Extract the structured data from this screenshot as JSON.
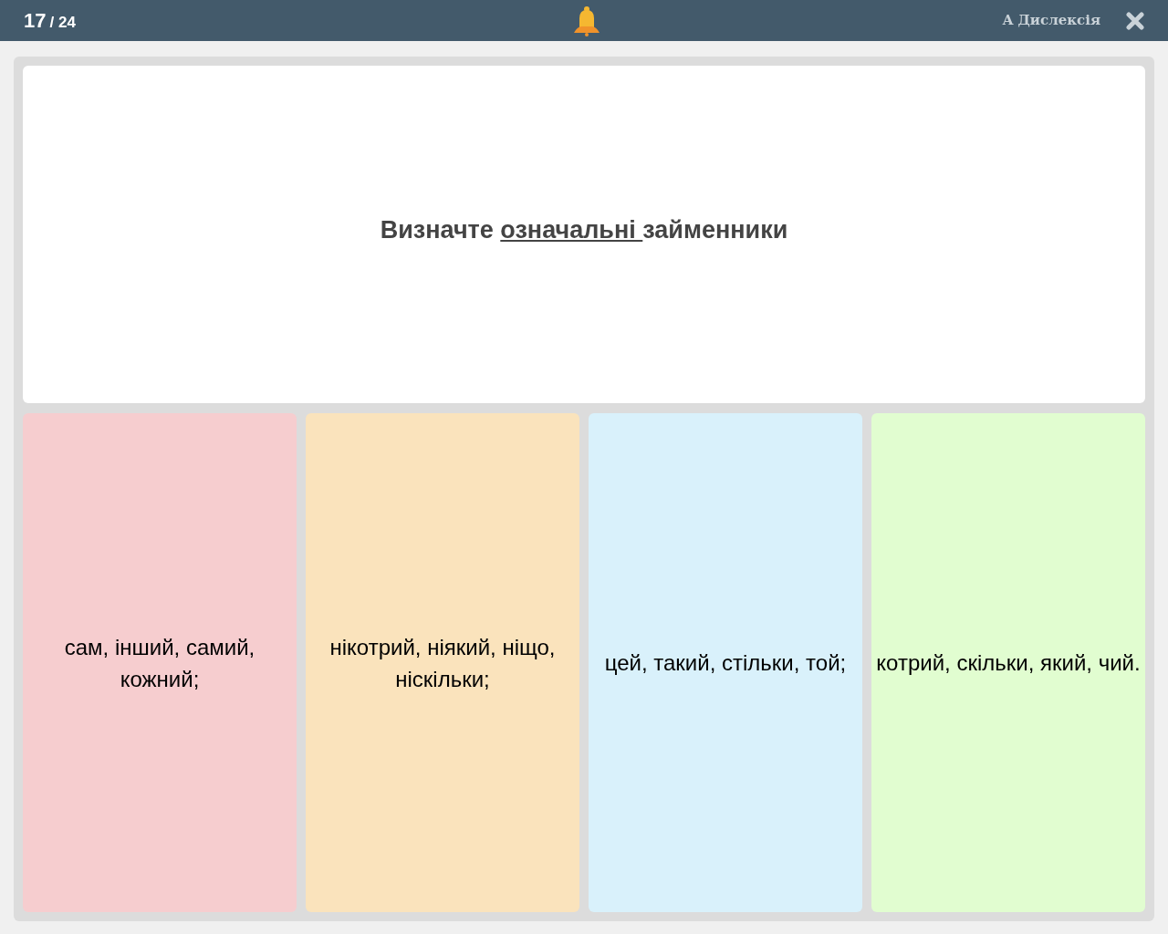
{
  "header": {
    "current": "17",
    "total": "/ 24",
    "dyslexia_label": "A Дислексія"
  },
  "question": [
    {
      "text": "Визначте ",
      "underlined": false
    },
    {
      "text": "означальні ",
      "underlined": true
    },
    {
      "text": "займенники",
      "underlined": false
    }
  ],
  "answers": [
    {
      "text": "сам, інший, самий, кожний;",
      "color": "#f6cdcf"
    },
    {
      "text": "нікотрий, ніякий, ніщо, ніскільки;",
      "color": "#fae3bc"
    },
    {
      "text": "цей, такий, стільки, той;",
      "color": "#d9f1fb"
    },
    {
      "text": "котрий, скільки, який, чий.",
      "color": "#e1fdd0"
    }
  ]
}
